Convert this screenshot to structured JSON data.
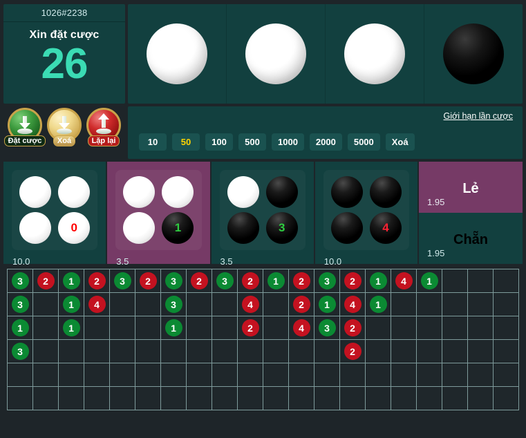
{
  "header": {
    "round_id": "1026#2238",
    "bet_prompt": "Xin đặt cược",
    "countdown": "26",
    "result_balls": [
      "white",
      "white",
      "white",
      "black"
    ]
  },
  "actions": [
    {
      "label": "Đặt cược",
      "style": "green",
      "icon": "arrow-down-icon"
    },
    {
      "label": "Xoá",
      "style": "gold",
      "icon": "arrow-down-icon"
    },
    {
      "label": "Lặp lại",
      "style": "red",
      "icon": "arrow-up-icon"
    }
  ],
  "chips_panel": {
    "limit_link": "Giới hạn lần cược",
    "chips": [
      {
        "label": "10",
        "selected": false
      },
      {
        "label": "50",
        "selected": true
      },
      {
        "label": "100",
        "selected": false
      },
      {
        "label": "500",
        "selected": false
      },
      {
        "label": "1000",
        "selected": false
      },
      {
        "label": "2000",
        "selected": false
      },
      {
        "label": "5000",
        "selected": false
      },
      {
        "label": "Xoá",
        "selected": false
      }
    ]
  },
  "bet_cells": [
    {
      "name": "cell-0",
      "odds": "10.0",
      "active": false,
      "balls": [
        {
          "color": "white",
          "label": ""
        },
        {
          "color": "white",
          "label": ""
        },
        {
          "color": "white",
          "label": ""
        },
        {
          "color": "white",
          "label": "0",
          "label_color": "#ff0000"
        }
      ]
    },
    {
      "name": "cell-1",
      "odds": "3.5",
      "active": true,
      "balls": [
        {
          "color": "white",
          "label": ""
        },
        {
          "color": "white",
          "label": ""
        },
        {
          "color": "white",
          "label": ""
        },
        {
          "color": "black",
          "label": "1",
          "label_color": "#2ecc40"
        }
      ]
    },
    {
      "name": "cell-2",
      "odds": "3.5",
      "active": false,
      "balls": [
        {
          "color": "white",
          "label": ""
        },
        {
          "color": "black",
          "label": ""
        },
        {
          "color": "black",
          "label": ""
        },
        {
          "color": "black",
          "label": "3",
          "label_color": "#2ecc40"
        }
      ]
    },
    {
      "name": "cell-3",
      "odds": "10.0",
      "active": false,
      "balls": [
        {
          "color": "black",
          "label": ""
        },
        {
          "color": "black",
          "label": ""
        },
        {
          "color": "black",
          "label": ""
        },
        {
          "color": "black",
          "label": "4",
          "label_color": "#ff2233"
        }
      ]
    }
  ],
  "odd_even": {
    "odd": {
      "title": "Lẻ",
      "odds": "1.95"
    },
    "even": {
      "title": "Chẵn",
      "odds": "1.95"
    }
  },
  "history": {
    "columns": 20,
    "rows": 6,
    "grid": [
      [
        "3",
        "2",
        "1",
        "2",
        "3",
        "2",
        "3",
        "2",
        "3",
        "2",
        "1",
        "2",
        "3",
        "2",
        "1",
        "4",
        "1",
        "",
        "",
        ""
      ],
      [
        "3",
        "",
        "1",
        "4",
        "",
        "",
        "3",
        "",
        "",
        "4",
        "",
        "2",
        "1",
        "4",
        "1",
        "",
        "",
        "",
        "",
        ""
      ],
      [
        "1",
        "",
        "1",
        "",
        "",
        "",
        "1",
        "",
        "",
        "2",
        "",
        "4",
        "3",
        "2",
        "",
        "",
        "",
        "",
        "",
        ""
      ],
      [
        "3",
        "",
        "",
        "",
        "",
        "",
        "",
        "",
        "",
        "",
        "",
        "",
        "",
        "2",
        "",
        "",
        "",
        "",
        "",
        ""
      ],
      [
        "",
        "",
        "",
        "",
        "",
        "",
        "",
        "",
        "",
        "",
        "",
        "",
        "",
        "",
        "",
        "",
        "",
        "",
        "",
        ""
      ],
      [
        "",
        "",
        "",
        "",
        "",
        "",
        "",
        "",
        "",
        "",
        "",
        "",
        "",
        "",
        "",
        "",
        "",
        "",
        "",
        ""
      ]
    ],
    "green_values": [
      "1",
      "3"
    ],
    "red_values": [
      "2",
      "4"
    ]
  },
  "colors": {
    "panel_teal": "#12403f",
    "accent_purple": "#763a66",
    "countdown_green": "#3bdcb4",
    "chip_selected": "#ffd400",
    "dot_green": "#0b8a33",
    "dot_red": "#c41220",
    "page_bg": "#1e2529"
  }
}
